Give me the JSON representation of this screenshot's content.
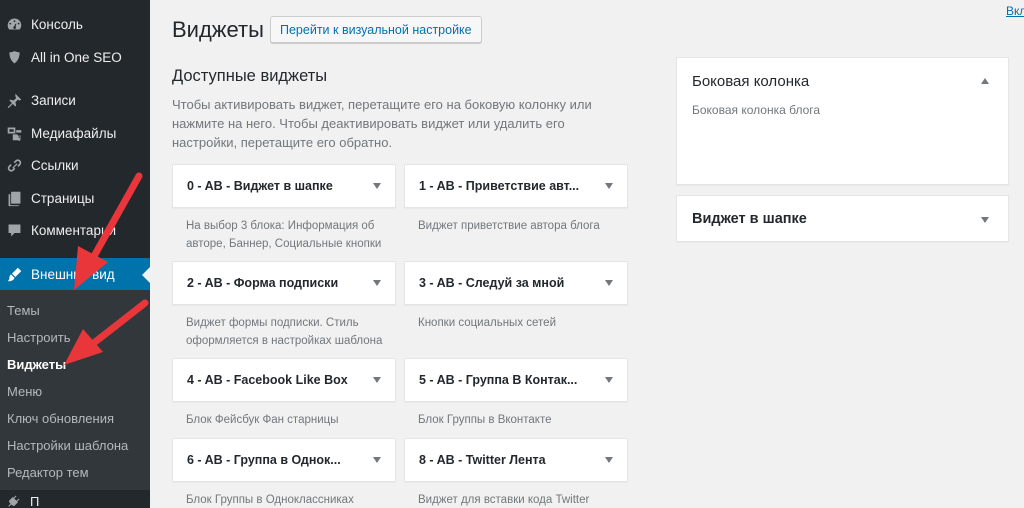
{
  "sidebar": {
    "items": [
      {
        "label": "Консоль",
        "icon": "dashboard-icon"
      },
      {
        "label": "All in One SEO",
        "icon": "shield-icon"
      },
      {
        "label": "Записи",
        "icon": "pin-icon"
      },
      {
        "label": "Медиафайлы",
        "icon": "media-icon"
      },
      {
        "label": "Ссылки",
        "icon": "link-icon"
      },
      {
        "label": "Страницы",
        "icon": "pages-icon"
      },
      {
        "label": "Комментарии",
        "icon": "comment-icon"
      },
      {
        "label": "Внешний вид",
        "icon": "brush-icon",
        "active": true
      }
    ],
    "submenu": [
      {
        "label": "Темы"
      },
      {
        "label": "Настроить"
      },
      {
        "label": "Виджеты",
        "current": true
      },
      {
        "label": "Меню"
      },
      {
        "label": "Ключ обновления"
      },
      {
        "label": "Настройки шаблона"
      },
      {
        "label": "Редактор тем"
      }
    ],
    "bottom_item": {
      "label": "П",
      "icon": "plugins-icon"
    }
  },
  "header": {
    "title": "Виджеты",
    "customize_button": "Перейти к визуальной настройке",
    "enable_link": "Вкл"
  },
  "available": {
    "title": "Доступные виджеты",
    "description": "Чтобы активировать виджет, перетащите его на боковую колонку или нажмите на него. Чтобы деактивировать виджет или удалить его настройки, перетащите его обратно.",
    "widgets": [
      {
        "title": "0 - AB - Виджет в шапке",
        "description": "На выбор 3 блока: Информация об авторе, Баннер, Социальные кнопки"
      },
      {
        "title": "1 - AB - Приветствие авт...",
        "description": "Виджет приветствие автора блога"
      },
      {
        "title": "2 - AB - Форма подписки",
        "description": "Виджет формы подписки. Стиль оформляется в настройках шаблона"
      },
      {
        "title": "3 - AB - Следуй за мной",
        "description": "Кнопки социальных сетей"
      },
      {
        "title": "4 - AB - Facebook Like Box",
        "description": "Блок Фейсбук Фан старницы"
      },
      {
        "title": "5 - AB - Группа В Контак...",
        "description": "Блок Группы в Вконтакте"
      },
      {
        "title": "6 - AB - Группа в Однок...",
        "description": "Блок Группы в Одноклассниках"
      },
      {
        "title": "8 - AB - Twitter Лента",
        "description": "Виджет для вставки кода Twitter"
      }
    ]
  },
  "widget_areas": [
    {
      "title": "Боковая колонка",
      "description": "Боковая колонка блога",
      "expanded": true
    },
    {
      "title": "Виджет в шапке",
      "description": "",
      "expanded": false
    }
  ],
  "colors": {
    "sidebar_bg": "#23282d",
    "submenu_bg": "#32373c",
    "active_bg": "#0073aa",
    "link": "#0073aa",
    "annotation_arrow": "#e8363a",
    "page_bg": "#f1f1f1"
  }
}
